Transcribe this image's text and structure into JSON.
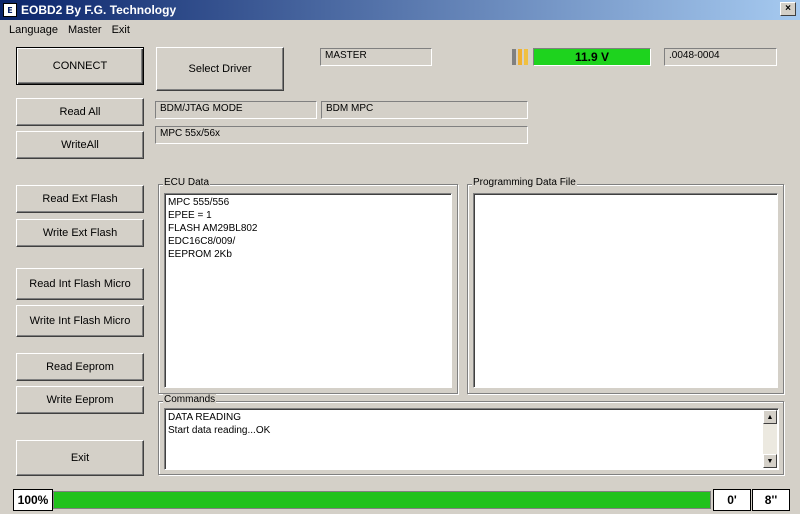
{
  "window": {
    "title": "EOBD2 By F.G. Technology",
    "icon_text": "E",
    "close_label": "×"
  },
  "menu": [
    "Language",
    "Master",
    "Exit"
  ],
  "buttons": {
    "connect": "CONNECT",
    "select_driver": "Select Driver",
    "read_all": "Read All",
    "write_all": "WriteAll",
    "read_ext_flash": "Read Ext Flash",
    "write_ext_flash": "Write Ext Flash",
    "read_int_flash": "Read Int Flash Micro",
    "write_int_flash": "Write Int Flash Micro",
    "read_eeprom": "Read Eeprom",
    "write_eeprom": "Write Eeprom",
    "exit": "Exit"
  },
  "header": {
    "master_field": "MASTER",
    "voltage": "11.9 V",
    "code_field": ".0048-0004",
    "voltage_color": "#1ed31e"
  },
  "mode": {
    "mode_field": "BDM/JTAG  MODE",
    "bdm_field": "BDM MPC",
    "processor_field": "MPC 55x/56x"
  },
  "ecu_data": {
    "label": "ECU Data",
    "lines": [
      "MPC 555/556",
      "EPEE = 1",
      "FLASH AM29BL802",
      "EDC16C8/009/",
      "EEPROM  2Kb"
    ]
  },
  "programming_file": {
    "label": "Programming Data File"
  },
  "commands": {
    "label": "Commands",
    "lines": [
      "DATA READING",
      "Start data reading...OK"
    ]
  },
  "status": {
    "percent": "100%",
    "progress": 1.0,
    "progress_color": "#21c21d",
    "minutes": "0'",
    "seconds": "8''"
  }
}
